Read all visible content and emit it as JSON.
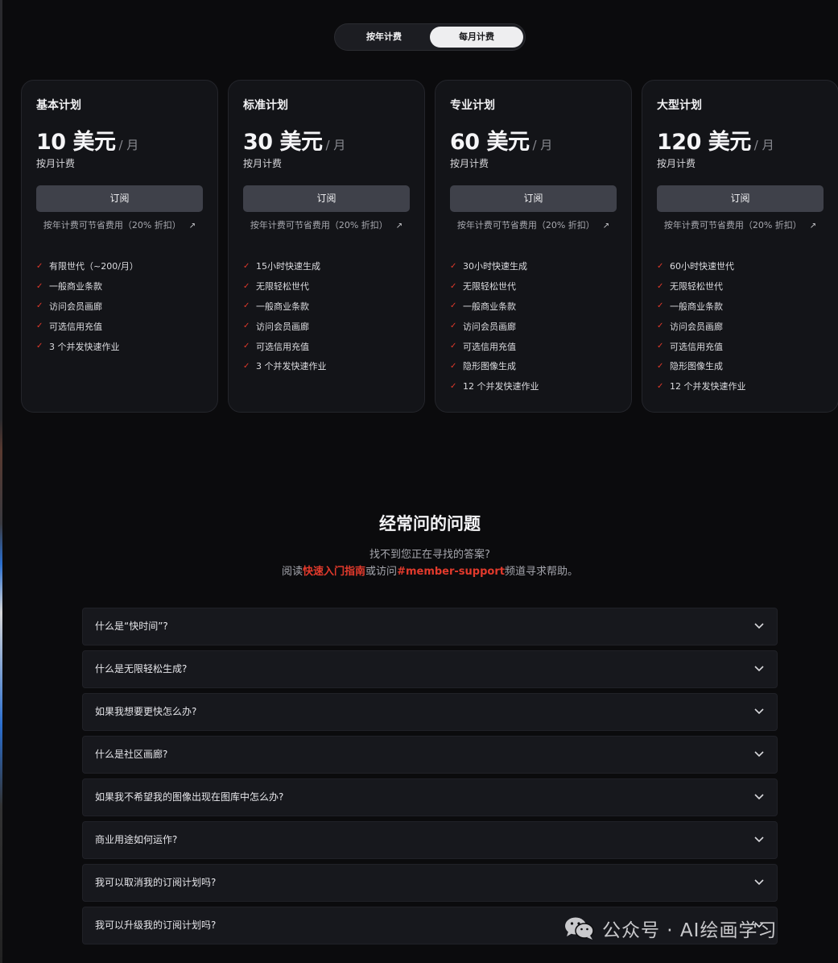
{
  "billing_toggle": {
    "yearly": "按年计费",
    "monthly": "每月计费",
    "selected": "monthly"
  },
  "plans": [
    {
      "name": "基本计划",
      "price": "10 美元",
      "per": "/ 月",
      "billing": "按月计费",
      "subscribe": "订阅",
      "save_note": "按年计费可节省费用（20% 折扣）",
      "save_arrow": "↗",
      "features": [
        "有限世代（~200/月）",
        "一般商业条款",
        "访问会员画廊",
        "可选信用充值",
        "3 个并发快速作业"
      ]
    },
    {
      "name": "标准计划",
      "price": "30 美元",
      "per": "/ 月",
      "billing": "按月计费",
      "subscribe": "订阅",
      "save_note": "按年计费可节省费用（20% 折扣）",
      "save_arrow": "↗",
      "features": [
        "15小时快速生成",
        "无限轻松世代",
        "一般商业条款",
        "访问会员画廊",
        "可选信用充值",
        "3 个并发快速作业"
      ]
    },
    {
      "name": "专业计划",
      "price": "60 美元",
      "per": "/ 月",
      "billing": "按月计费",
      "subscribe": "订阅",
      "save_note": "按年计费可节省费用（20% 折扣）",
      "save_arrow": "↗",
      "features": [
        "30小时快速生成",
        "无限轻松世代",
        "一般商业条款",
        "访问会员画廊",
        "可选信用充值",
        "隐形图像生成",
        "12 个并发快速作业"
      ]
    },
    {
      "name": "大型计划",
      "price": "120 美元",
      "per": "/ 月",
      "billing": "按月计费",
      "subscribe": "订阅",
      "save_note": "按年计费可节省费用（20% 折扣）",
      "save_arrow": "↗",
      "features": [
        "60小时快速世代",
        "无限轻松世代",
        "一般商业条款",
        "访问会员画廊",
        "可选信用充值",
        "隐形图像生成",
        "12 个并发快速作业"
      ]
    }
  ],
  "faq": {
    "title": "经常问的问题",
    "subtitle": "找不到您正在寻找的答案?",
    "help_prefix": "阅读",
    "help_link1": "快速入门指南",
    "help_middle": "或访问",
    "help_link2": "#member-support",
    "help_suffix": "频道寻求帮助。",
    "questions": [
      "什么是“快时间”?",
      "什么是无限轻松生成?",
      "如果我想要更快怎么办?",
      "什么是社区画廊?",
      "如果我不希望我的图像出现在图库中怎么办?",
      "商业用途如何运作?",
      "我可以取消我的订阅计划吗?",
      "我可以升级我的订阅计划吗?"
    ]
  },
  "watermark": {
    "text": "公众号 · AI绘画学习"
  },
  "colors": {
    "accent": "#e23a2c",
    "card_bg": "#131418",
    "button_bg": "#3f414a",
    "page_bg": "#0b0b0d"
  }
}
